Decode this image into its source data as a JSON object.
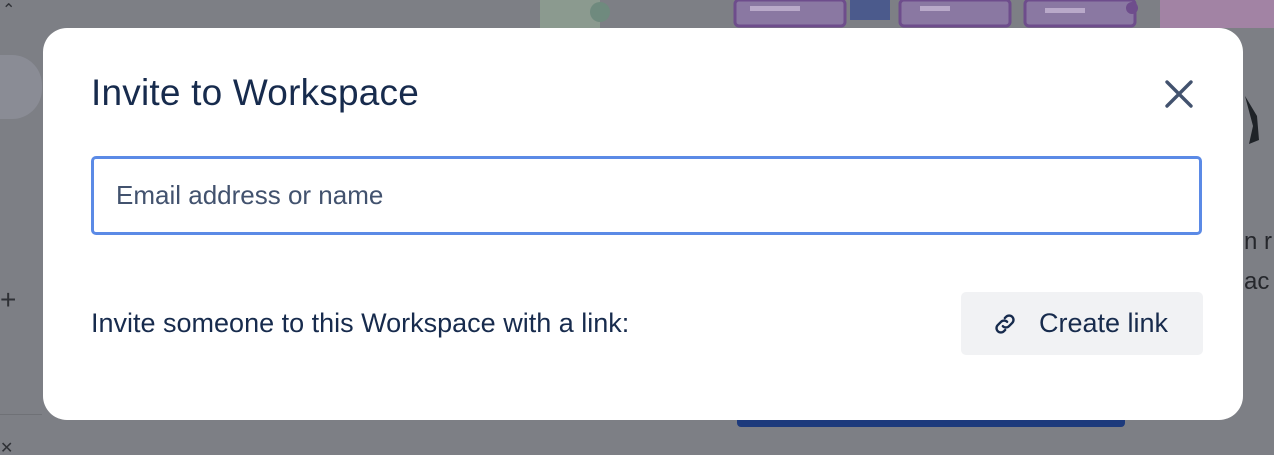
{
  "dialog": {
    "title": "Invite to Workspace",
    "close_icon": "close-icon",
    "email_placeholder": "Email address or name",
    "email_value": "",
    "link_prompt": "Invite someone to this Workspace with a link:",
    "create_link_label": "Create link",
    "create_link_icon": "link-icon"
  },
  "colors": {
    "title": "#172b4d",
    "input_border": "#5b8ae6",
    "button_bg": "#f1f2f4",
    "overlay": "#7d7f85"
  }
}
